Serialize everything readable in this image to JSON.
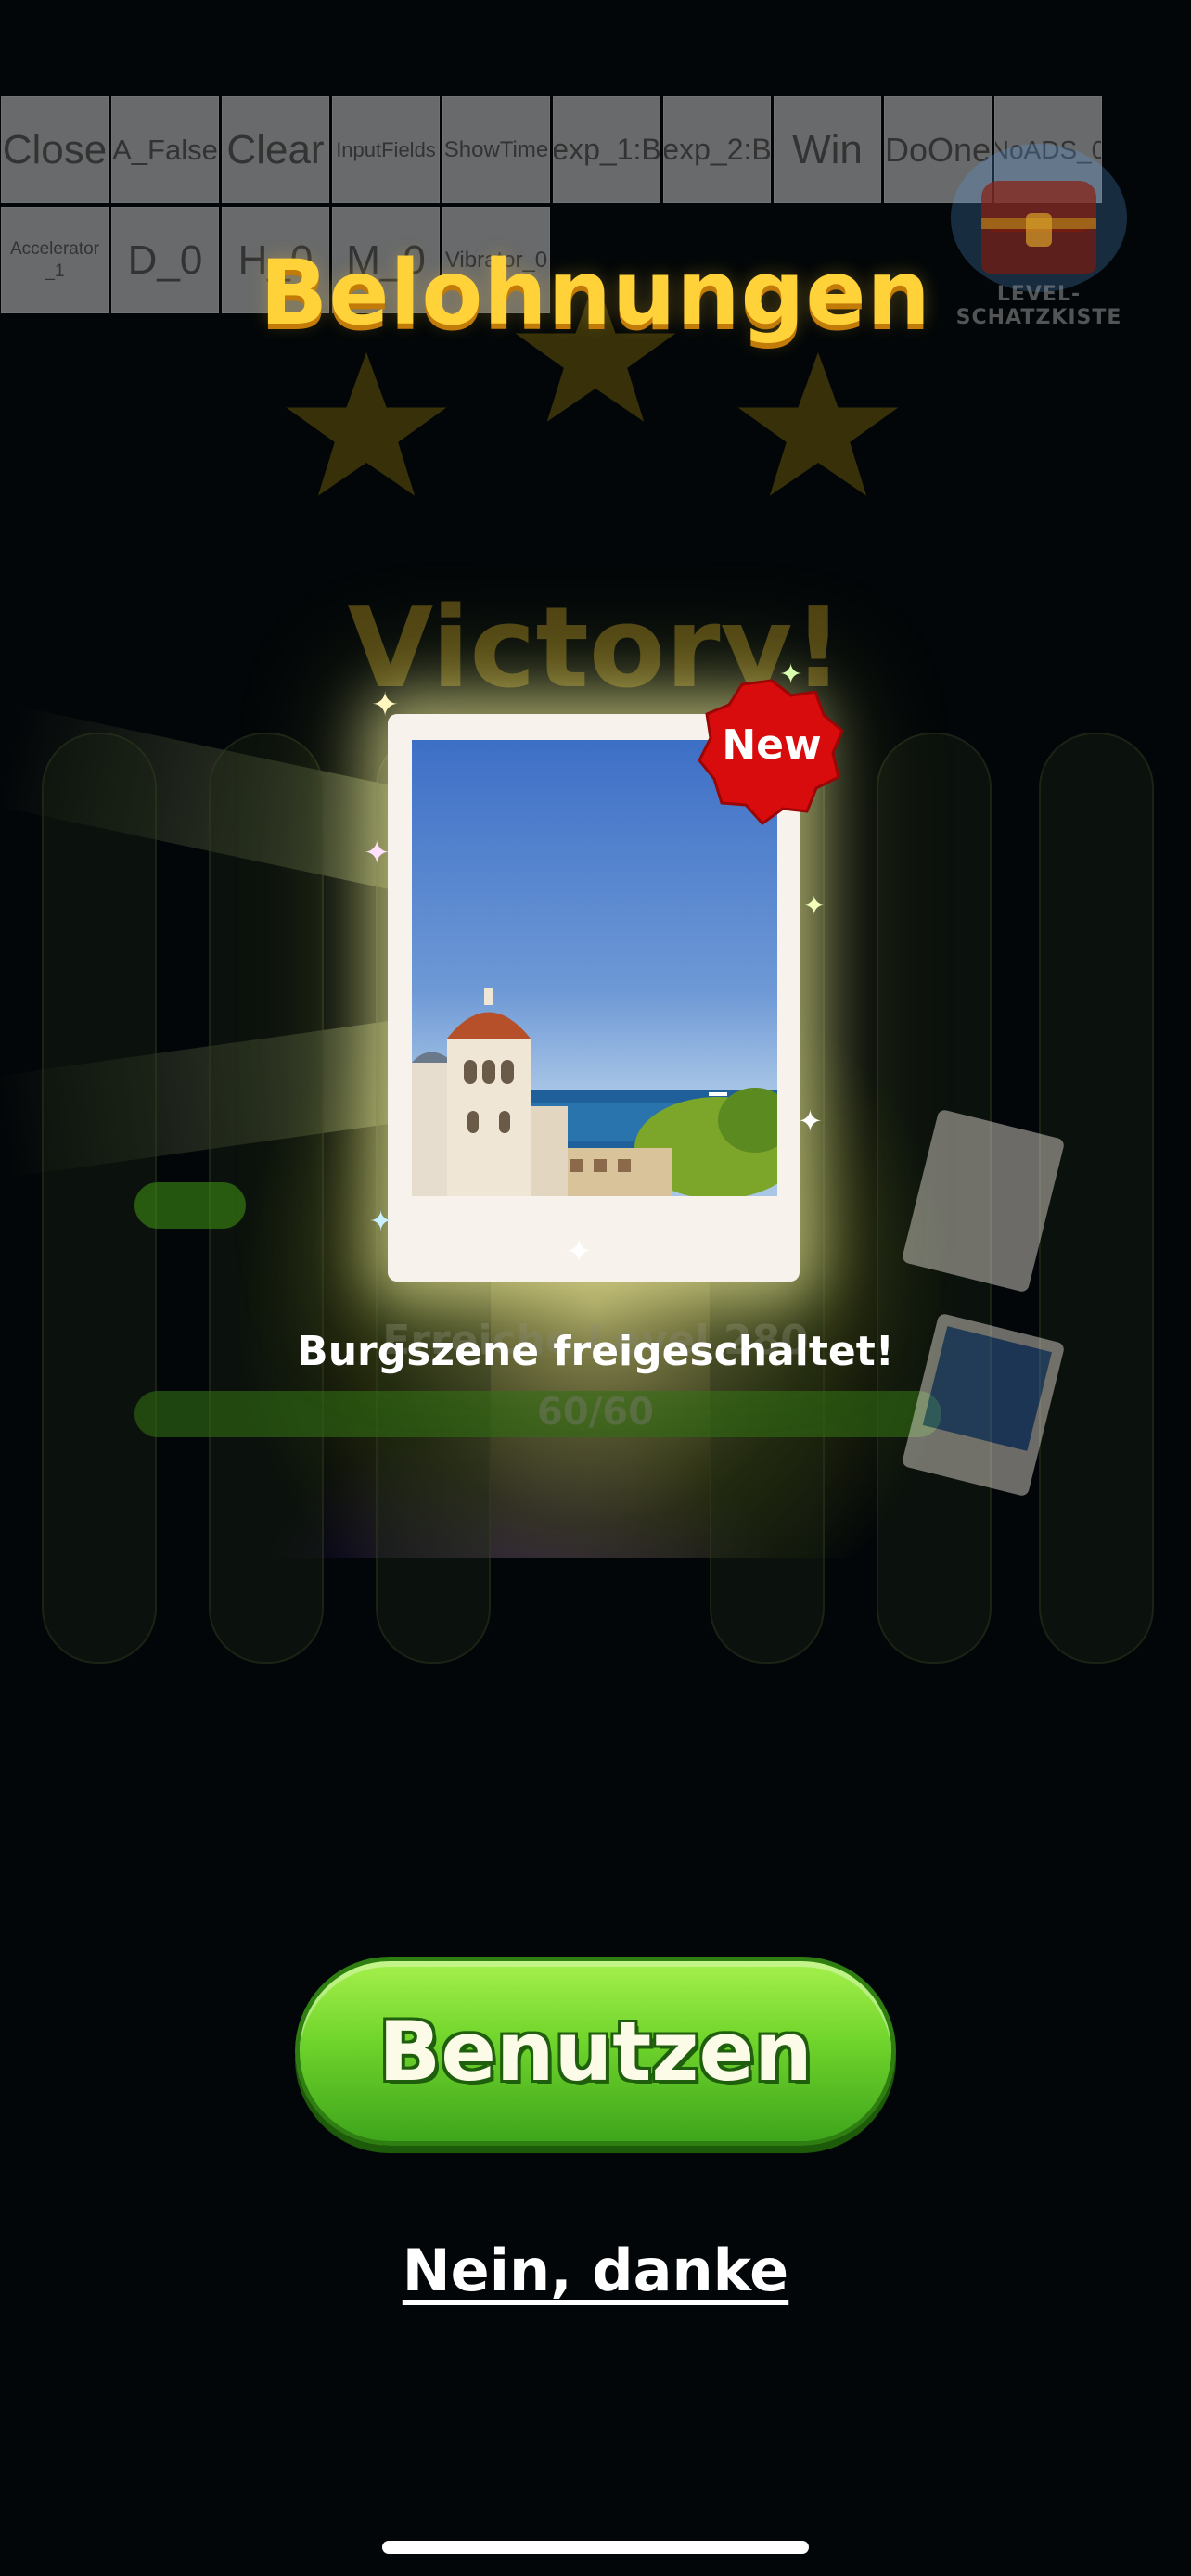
{
  "debug_toolbar": {
    "row1": [
      "Close",
      "A_False",
      "Clear",
      "InputFields",
      "ShowTime",
      "exp_1:B",
      "exp_2:B",
      "Win",
      "DoOne",
      "NoADS_0"
    ],
    "row2": [
      "Accelerator_1",
      "D_0",
      "H_0",
      "M_0",
      "Vibrator_0"
    ]
  },
  "chest": {
    "label": "LEVEL-SCHATZKISTE"
  },
  "title": "Belohnungen",
  "background": {
    "victory": "Victory!",
    "level_text": "Erreiche Level 280",
    "progress": "60/60"
  },
  "reward": {
    "badge": "New",
    "caption": "Burgszene freigeschaltet!"
  },
  "buttons": {
    "use": "Benutzen",
    "no_thanks": "Nein, danke"
  },
  "colors": {
    "title": "#ffd23a",
    "button_green": "#6fd42b",
    "badge_red": "#e01010",
    "background": "#020608"
  }
}
